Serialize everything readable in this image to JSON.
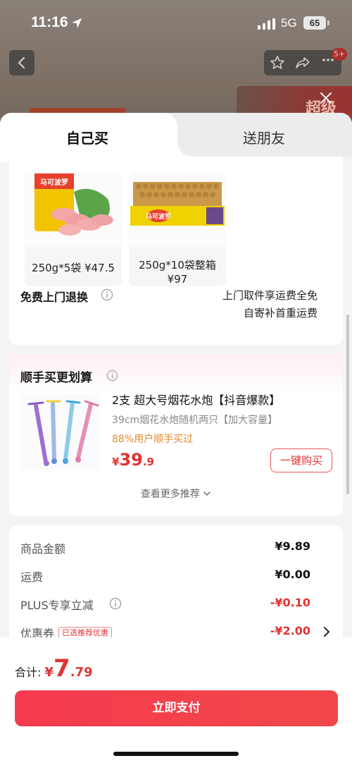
{
  "status_bar": {
    "time": "11:16",
    "network": "5G",
    "battery": "65"
  },
  "background_page": {
    "cart_badge": "5+",
    "banner_text": "超级"
  },
  "tabs": [
    {
      "label": "自己买",
      "active": true
    },
    {
      "label": "送朋友",
      "active": false
    }
  ],
  "specs": [
    {
      "label": "250g*5袋  ¥47.5"
    },
    {
      "label_line1": "250g*10袋整箱",
      "label_line2": "¥97"
    }
  ],
  "return_service": {
    "label": "免费上门退换",
    "line1": "上门取件享运费全免",
    "line2": "自寄补首重运费"
  },
  "addon": {
    "section_title": "顺手买更划算",
    "name": "2支 超大号烟花水炮【抖音爆款】",
    "subtitle": "39cm烟花水炮随机两只【加大容量】",
    "social_proof": "88%用户顺手买过",
    "price_currency": "¥",
    "price_int": "39",
    "price_dec": ".9",
    "buy_label": "一键购买",
    "see_more": "查看更多推荐"
  },
  "summary": {
    "rows": [
      {
        "label": "商品金额",
        "value": "¥9.89"
      },
      {
        "label": "运费",
        "value": "¥0.00"
      },
      {
        "label": "PLUS专享立减",
        "value": "-¥0.10"
      },
      {
        "label": "优惠券",
        "tag": "已选推荐优惠",
        "value": "-¥2.00"
      }
    ]
  },
  "total": {
    "label": "合计:",
    "currency": "¥",
    "int": "7",
    "dec": ".79"
  },
  "pay_button": "立即支付",
  "colors": {
    "accent_red": "#e33333",
    "pay_button": "#f63b4e",
    "social_orange": "#e08a2c"
  }
}
